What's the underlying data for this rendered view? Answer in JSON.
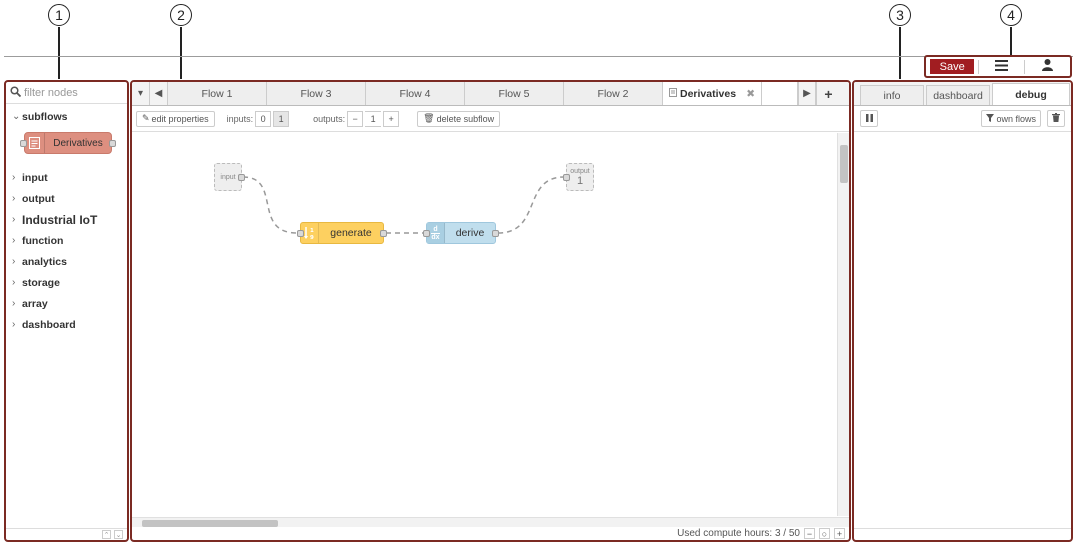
{
  "callouts": [
    "1",
    "2",
    "3",
    "4"
  ],
  "header": {
    "save_label": "Save",
    "menu_icon": "hamburger-menu-icon",
    "user_icon": "user-icon"
  },
  "palette": {
    "filter_placeholder": "filter nodes",
    "subflows_label": "subflows",
    "subflow_node_label": "Derivatives",
    "categories": [
      "input",
      "output",
      "Industrial IoT",
      "function",
      "analytics",
      "storage",
      "array",
      "dashboard"
    ],
    "footer_up": "⌃",
    "footer_down": "⌄"
  },
  "workspace": {
    "tabs": [
      "Flow 1",
      "Flow 3",
      "Flow 4",
      "Flow 5",
      "Flow 2"
    ],
    "active_tab": "Derivatives",
    "toolbar": {
      "edit_properties": "edit properties",
      "inputs_label": "inputs:",
      "inputs_options": [
        "0",
        "1"
      ],
      "outputs_label": "outputs:",
      "outputs_value": "1",
      "delete_subflow": "delete subflow"
    },
    "nodes": {
      "input_label": "input",
      "output_label": "output",
      "output_number": "1",
      "generate_label": "generate",
      "generate_icon_text": "1 9",
      "derive_label": "derive",
      "derive_icon_text": "d dx"
    },
    "status_text": "Used compute hours: 3 / 50"
  },
  "sidebar": {
    "tabs": [
      "info",
      "dashboard",
      "debug"
    ],
    "active_tab": "debug",
    "own_flows_label": "own flows"
  },
  "colors": {
    "frame": "#7b2a23",
    "save": "#a11d21",
    "subflow_node": "#dd8f80",
    "generate_node": "#fdd060",
    "derive_node": "#c0deed"
  }
}
